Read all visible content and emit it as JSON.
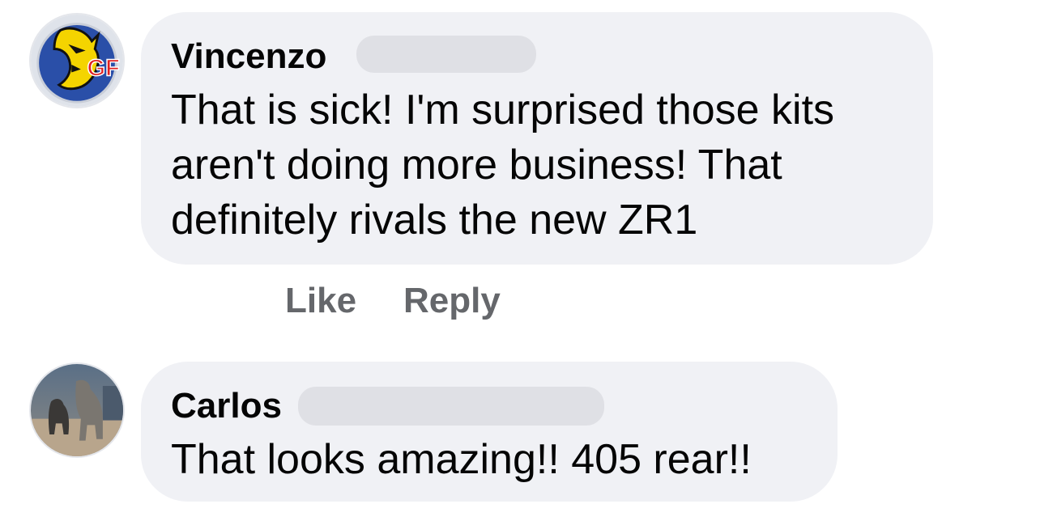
{
  "comments": [
    {
      "author": "Vincenzo",
      "avatar_icon": "gf-logo-avatar",
      "text": "That is sick! I'm surprised those kits\naren't doing more business! That\ndefinitely rivals the new ZR1",
      "actions": {
        "like": "Like",
        "reply": "Reply"
      }
    },
    {
      "author": "Carlos",
      "avatar_icon": "dogs-photo-avatar",
      "text": "That looks amazing!! 405 rear!!"
    }
  ],
  "colors": {
    "bubble": "#f0f1f5",
    "action_text": "#65676b",
    "redaction": "#dfe0e5"
  }
}
